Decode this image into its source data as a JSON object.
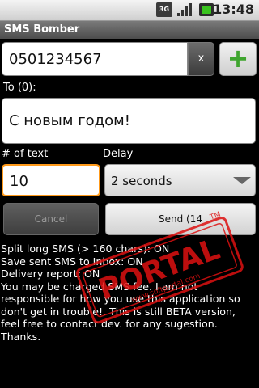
{
  "status_bar": {
    "network_label": "3G",
    "time": "13:48"
  },
  "app": {
    "title": "SMS Bomber"
  },
  "phone": {
    "value": "0501234567",
    "clear_label": "x",
    "add_label": "+"
  },
  "recipients": {
    "label": "To (0):"
  },
  "message": {
    "text": "С новым годом!"
  },
  "count": {
    "label": "# of text",
    "value": "10"
  },
  "delay": {
    "label": "Delay",
    "value": "2 seconds"
  },
  "actions": {
    "cancel_label": "Cancel",
    "send_label": "Send (14"
  },
  "info": {
    "line1": "Split long SMS (> 160 chars): ON",
    "line2": "Save sent SMS to Inbox: ON",
    "line3": "Delivery report: ON",
    "line4": "You may be charged SMS fee. I am not",
    "line5": "responsible for how you use this application so",
    "line6": "don't get in trouble!. This is still BETA version,",
    "line7": "feel free to contact dev. for any sugestion.",
    "line8": "Thanks."
  },
  "watermark": {
    "text": "PORTAL",
    "sub": "www.softportal.com",
    "tm": "TM"
  },
  "colors": {
    "accent_focus": "#ff9a1a",
    "add_green": "#3fa52f",
    "watermark_red": "#d11"
  }
}
